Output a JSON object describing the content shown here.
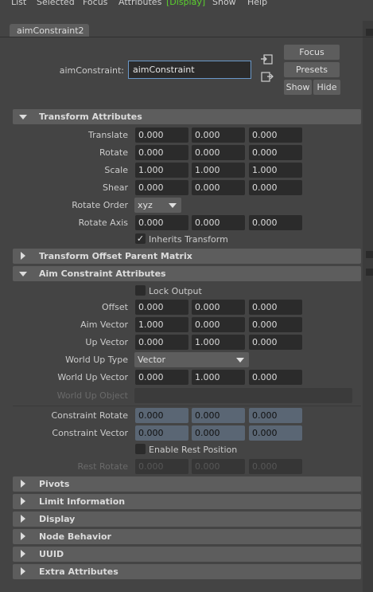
{
  "menubar": {
    "items": [
      "List",
      "Selected",
      "Focus",
      "Attributes",
      "[Display]",
      "Show",
      "Help"
    ]
  },
  "tab": {
    "label": "aimConstraint2"
  },
  "header": {
    "node_label": "aimConstraint:",
    "node_value": "aimConstraint",
    "focus": "Focus",
    "presets": "Presets",
    "show": "Show",
    "hide": "Hide",
    "icon_load": "load-attributes-icon",
    "icon_copy": "copy-tab-icon"
  },
  "transform": {
    "title": "Transform Attributes",
    "translate": {
      "label": "Translate",
      "values": [
        "0.000",
        "0.000",
        "0.000"
      ]
    },
    "rotate": {
      "label": "Rotate",
      "values": [
        "0.000",
        "0.000",
        "0.000"
      ]
    },
    "scale": {
      "label": "Scale",
      "values": [
        "1.000",
        "1.000",
        "1.000"
      ]
    },
    "shear": {
      "label": "Shear",
      "values": [
        "0.000",
        "0.000",
        "0.000"
      ]
    },
    "rotate_order": {
      "label": "Rotate Order",
      "value": "xyz"
    },
    "rotate_axis": {
      "label": "Rotate Axis",
      "values": [
        "0.000",
        "0.000",
        "0.000"
      ]
    },
    "inherits": {
      "label": "Inherits Transform",
      "checked": true
    }
  },
  "offset_matrix": {
    "title": "Transform Offset Parent Matrix"
  },
  "aim": {
    "title": "Aim Constraint Attributes",
    "lock_output": {
      "label": "Lock Output",
      "checked": false
    },
    "offset": {
      "label": "Offset",
      "values": [
        "0.000",
        "0.000",
        "0.000"
      ]
    },
    "aim_vector": {
      "label": "Aim Vector",
      "values": [
        "1.000",
        "0.000",
        "0.000"
      ]
    },
    "up_vector": {
      "label": "Up Vector",
      "values": [
        "0.000",
        "1.000",
        "0.000"
      ]
    },
    "world_up_type": {
      "label": "World Up Type",
      "value": "Vector"
    },
    "world_up_vector": {
      "label": "World Up Vector",
      "values": [
        "0.000",
        "1.000",
        "0.000"
      ]
    },
    "world_up_object": {
      "label": "World Up Object"
    },
    "constraint_rotate": {
      "label": "Constraint Rotate",
      "values": [
        "0.000",
        "0.000",
        "0.000"
      ]
    },
    "constraint_vector": {
      "label": "Constraint Vector",
      "values": [
        "0.000",
        "0.000",
        "0.000"
      ]
    },
    "enable_rest": {
      "label": "Enable Rest Position",
      "checked": false
    },
    "rest_rotate": {
      "label": "Rest Rotate",
      "values": [
        "0.000",
        "0.000",
        "0.000"
      ]
    }
  },
  "sections": {
    "pivots": "Pivots",
    "limit": "Limit Information",
    "display": "Display",
    "node_behavior": "Node Behavior",
    "uuid": "UUID",
    "extra": "Extra Attributes"
  },
  "colors": {
    "panel_bg": "#444444",
    "field_bg": "#2b2b2b",
    "header_bg": "#5d5d5d",
    "constraint_field_bg": "#5a6674",
    "menu_active": "#5bd02e",
    "input_border": "#6a98c9"
  }
}
